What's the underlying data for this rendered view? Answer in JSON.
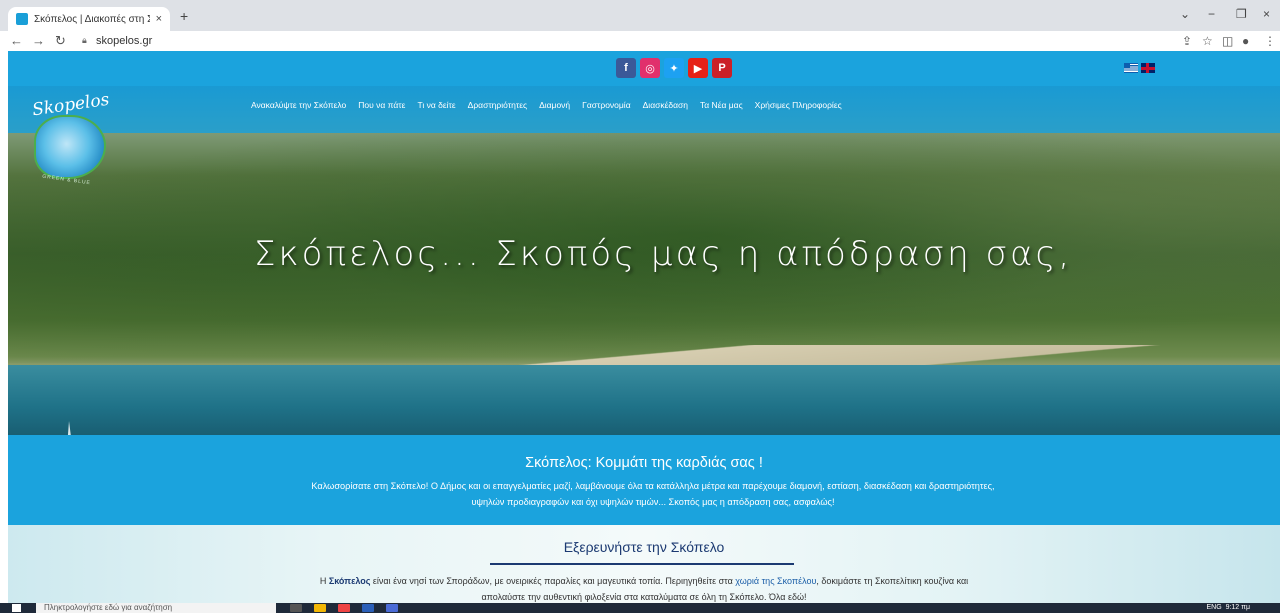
{
  "browser": {
    "tab_title": "Σκόπελος | Διακοπές στη Σκόπε...",
    "tab_close": "×",
    "new_tab": "+",
    "url": "skopelos.gr",
    "window_controls": {
      "minimize": "−",
      "restore": "❐",
      "close": "×",
      "menu": "⌄"
    }
  },
  "site": {
    "social": [
      {
        "name": "facebook-icon",
        "glyph": "f",
        "color": "#3b5998"
      },
      {
        "name": "instagram-icon",
        "glyph": "◎",
        "color": "#e1306c"
      },
      {
        "name": "twitter-icon",
        "glyph": "✦",
        "color": "#1da1f2"
      },
      {
        "name": "youtube-icon",
        "glyph": "▶",
        "color": "#e62117"
      },
      {
        "name": "pinterest-icon",
        "glyph": "P",
        "color": "#cb2027"
      }
    ],
    "logo_text": "Skopelos",
    "logo_tagline": "GREEN & BLUE",
    "menu": [
      "Ανακαλύψτε την Σκόπελο",
      "Που να πάτε",
      "Τι να δείτε",
      "Δραστηριότητες",
      "Διαμονή",
      "Γαστρονομία",
      "Διασκέδαση",
      "Τα Νέα μας",
      "Χρήσιμες Πληροφορίες"
    ],
    "hero_slogan": "Σκόπελος... Σκοπός μας η απόδραση σας,",
    "welcome": {
      "title": "Σκόπελος: Κομμάτι της καρδιάς σας !",
      "text": "Καλωσορίσατε στη Σκόπελο! Ο Δήμος και οι επαγγελματίες μαζί, λαμβάνουμε όλα τα κατάλληλα μέτρα και παρέχουμε διαμονή, εστίαση, διασκέδαση και δραστηριότητες, υψηλών προδιαγραφών και όχι υψηλών τιμών... Σκοπός μας η απόδραση σας, ασφαλώς!"
    },
    "explore": {
      "title": "Εξερευνήστε την Σκόπελο",
      "intro_prefix": "Η ",
      "intro_bold": "Σκόπελος",
      "intro_mid": " είναι ένα νησί των Σποράδων, με ονειρικές παραλίες και μαγευτικά τοπία. Περιηγηθείτε στα ",
      "intro_link": "χωριά της Σκοπέλου",
      "intro_end": ", δοκιμάστε τη Σκοπελίτικη κουζίνα και απολαύστε την αυθεντική φιλοξενία στα καταλύματα σε όλη τη Σκόπελο. Όλα εδώ!"
    }
  },
  "taskbar": {
    "search_placeholder": "Πληκτρολογήστε εδώ για αναζήτηση",
    "tray_lang": "ENG",
    "tray_time": "9:12 πμ"
  }
}
